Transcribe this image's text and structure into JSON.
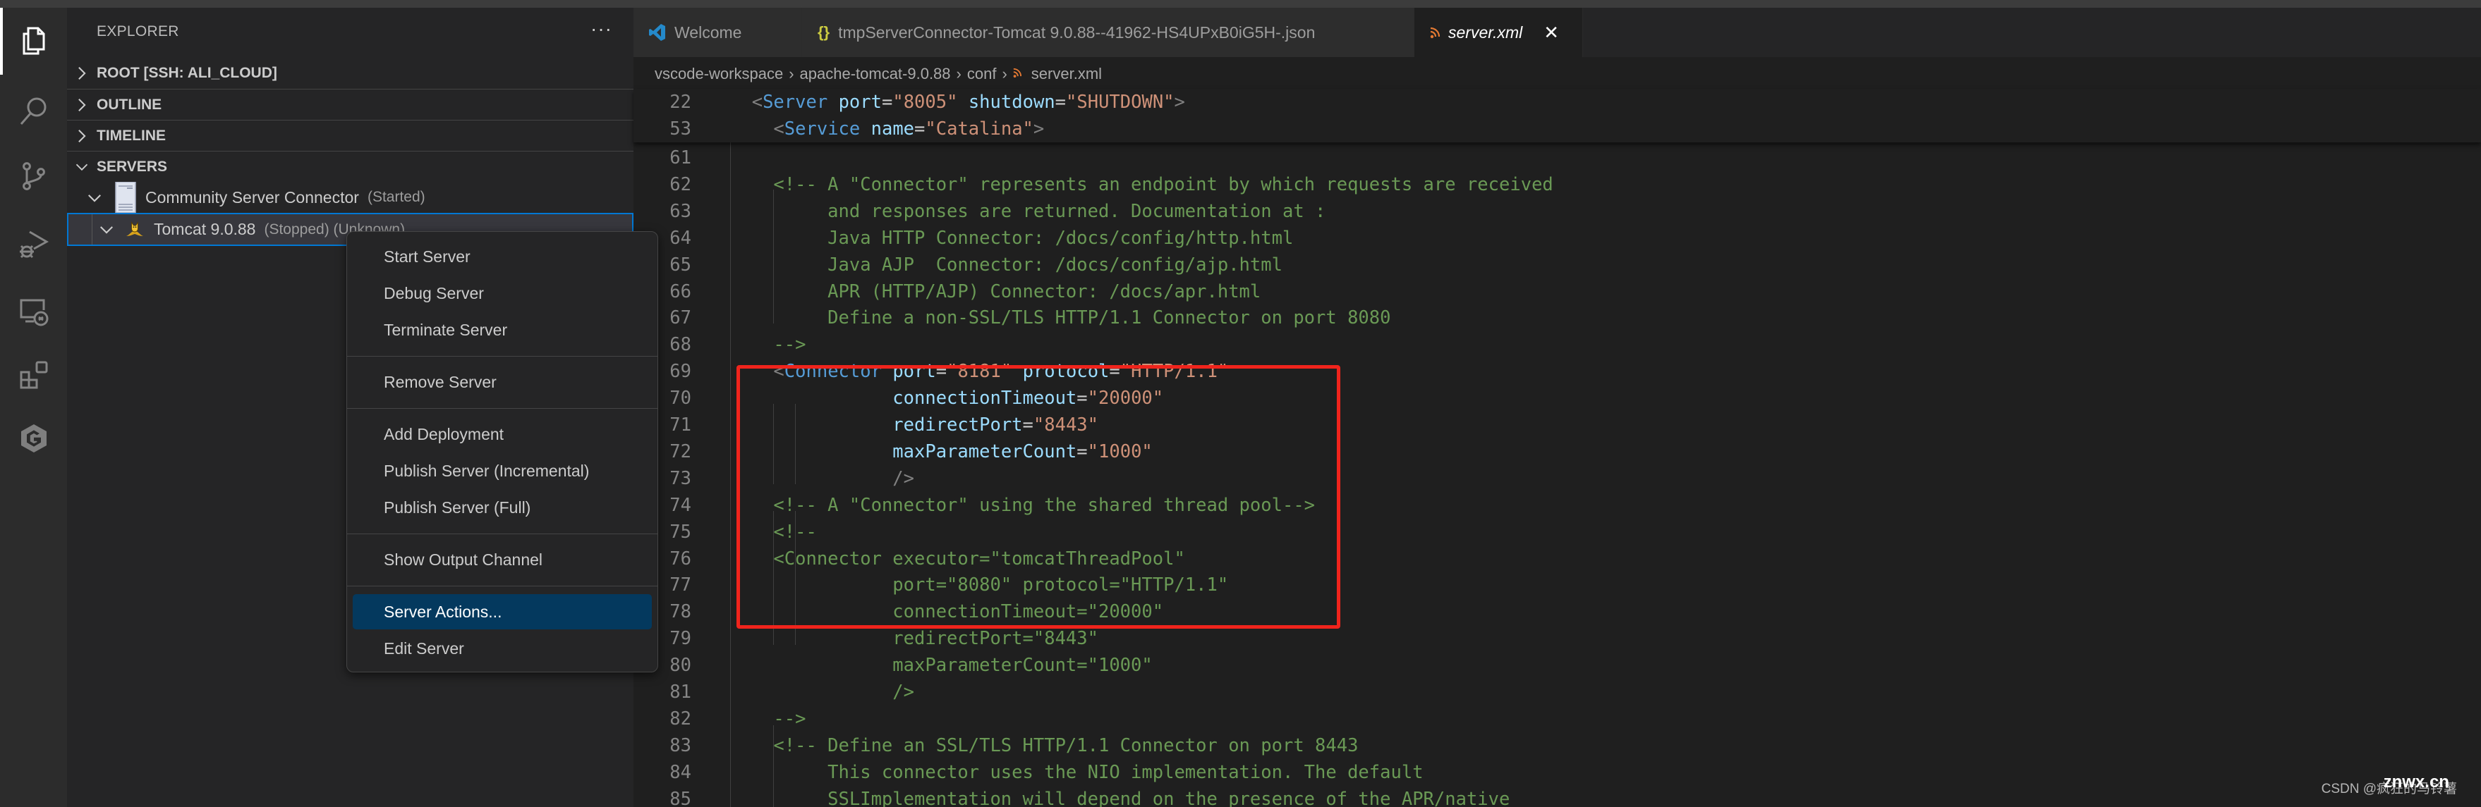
{
  "activity_bar": {
    "items": [
      {
        "name": "explorer",
        "active": true
      },
      {
        "name": "search",
        "active": false
      },
      {
        "name": "source-control",
        "active": false
      },
      {
        "name": "run-and-debug",
        "active": false
      },
      {
        "name": "remote-explorer",
        "active": false
      },
      {
        "name": "extensions",
        "active": false
      },
      {
        "name": "gitlens",
        "active": false
      }
    ]
  },
  "sidebar": {
    "title": "EXPLORER",
    "more_label": "···",
    "sections": [
      {
        "label": "ROOT [SSH: ALI_CLOUD]",
        "expanded": false
      },
      {
        "label": "OUTLINE",
        "expanded": false
      },
      {
        "label": "TIMELINE",
        "expanded": false
      },
      {
        "label": "SERVERS",
        "expanded": true
      }
    ],
    "servers_tree": [
      {
        "label": "Community Server Connector",
        "description": "(Started)",
        "icon": "server-icon",
        "expanded": true
      },
      {
        "label": "Tomcat 9.0.88",
        "description": "(Stopped) (Unknown)",
        "icon": "tomcat-icon",
        "expanded": true,
        "selected": true
      }
    ]
  },
  "context_menu": {
    "groups": [
      [
        "Start Server",
        "Debug Server",
        "Terminate Server"
      ],
      [
        "Remove Server"
      ],
      [
        "Add Deployment",
        "Publish Server (Incremental)",
        "Publish Server (Full)"
      ],
      [
        "Show Output Channel"
      ],
      [
        "Server Actions...",
        "Edit Server"
      ]
    ],
    "items": [
      "Start Server",
      "Debug Server",
      "Terminate Server",
      "Remove Server",
      "Add Deployment",
      "Publish Server (Incremental)",
      "Publish Server (Full)",
      "Show Output Channel",
      "Server Actions...",
      "Edit Server"
    ],
    "highlighted": "Server Actions..."
  },
  "tabs": [
    {
      "label": "Welcome",
      "icon": "vscode-icon",
      "active": false
    },
    {
      "label": "tmpServerConnector-Tomcat 9.0.88--41962-HS4UPxB0iG5H-.json",
      "icon": "json-icon",
      "active": false
    },
    {
      "label": "server.xml",
      "icon": "xml-rss-icon",
      "active": true,
      "close_label": "✕"
    }
  ],
  "breadcrumb": [
    "vscode-workspace",
    "apache-tomcat-9.0.88",
    "conf",
    "server.xml"
  ],
  "sticky_lines": [
    {
      "num": "22",
      "tokens": [
        [
          "  ",
          "pad"
        ],
        [
          "<",
          "bracket"
        ],
        [
          "Server",
          "tag"
        ],
        [
          " ",
          ""
        ],
        [
          "port",
          "attr"
        ],
        [
          "=",
          "eq"
        ],
        [
          "\"8005\"",
          "str"
        ],
        [
          " ",
          ""
        ],
        [
          "shutdown",
          "attr"
        ],
        [
          "=",
          "eq"
        ],
        [
          "\"SHUTDOWN\"",
          "str"
        ],
        [
          ">",
          "bracket"
        ]
      ]
    },
    {
      "num": "53",
      "tokens": [
        [
          "    ",
          "pad"
        ],
        [
          "<",
          "bracket"
        ],
        [
          "Service",
          "tag"
        ],
        [
          " ",
          ""
        ],
        [
          "name",
          "attr"
        ],
        [
          "=",
          "eq"
        ],
        [
          "\"Catalina\"",
          "str"
        ],
        [
          ">",
          "bracket"
        ]
      ]
    }
  ],
  "code_lines": [
    {
      "num": "61",
      "tokens": []
    },
    {
      "num": "62",
      "tokens": [
        [
          "    <!-- A \"Connector\" represents an endpoint by which requests are received",
          "com"
        ]
      ]
    },
    {
      "num": "63",
      "tokens": [
        [
          "         and responses are returned. Documentation at :",
          "com"
        ]
      ]
    },
    {
      "num": "64",
      "tokens": [
        [
          "         Java HTTP Connector: /docs/config/http.html",
          "com"
        ]
      ]
    },
    {
      "num": "65",
      "tokens": [
        [
          "         Java AJP  Connector: /docs/config/ajp.html",
          "com"
        ]
      ]
    },
    {
      "num": "66",
      "tokens": [
        [
          "         APR (HTTP/AJP) Connector: /docs/apr.html",
          "com"
        ]
      ]
    },
    {
      "num": "67",
      "tokens": [
        [
          "         Define a non-SSL/TLS HTTP/1.1 Connector on port 8080",
          "com"
        ]
      ]
    },
    {
      "num": "68",
      "tokens": [
        [
          "    -->",
          "com"
        ]
      ]
    },
    {
      "num": "69",
      "tokens": [
        [
          "    ",
          ""
        ],
        [
          "<",
          "bracket"
        ],
        [
          "Connector",
          "tag"
        ],
        [
          " ",
          ""
        ],
        [
          "port",
          "attr"
        ],
        [
          "=",
          "eq"
        ],
        [
          "\"8181\"",
          "str"
        ],
        [
          " ",
          ""
        ],
        [
          "protocol",
          "attr"
        ],
        [
          "=",
          "eq"
        ],
        [
          "\"HTTP/1.1\"",
          "str"
        ]
      ]
    },
    {
      "num": "70",
      "tokens": [
        [
          "               ",
          ""
        ],
        [
          "connectionTimeout",
          "attr"
        ],
        [
          "=",
          "eq"
        ],
        [
          "\"20000\"",
          "str"
        ]
      ]
    },
    {
      "num": "71",
      "tokens": [
        [
          "               ",
          ""
        ],
        [
          "redirectPort",
          "attr"
        ],
        [
          "=",
          "eq"
        ],
        [
          "\"8443\"",
          "str"
        ]
      ]
    },
    {
      "num": "72",
      "tokens": [
        [
          "               ",
          ""
        ],
        [
          "maxParameterCount",
          "attr"
        ],
        [
          "=",
          "eq"
        ],
        [
          "\"1000\"",
          "str"
        ]
      ]
    },
    {
      "num": "73",
      "tokens": [
        [
          "               ",
          ""
        ],
        [
          "/>",
          "bracket"
        ]
      ]
    },
    {
      "num": "74",
      "tokens": [
        [
          "    <!-- A \"Connector\" using the shared thread pool-->",
          "com"
        ]
      ]
    },
    {
      "num": "75",
      "tokens": [
        [
          "    <!--",
          "com"
        ]
      ]
    },
    {
      "num": "76",
      "tokens": [
        [
          "    <Connector executor=\"tomcatThreadPool\"",
          "com"
        ]
      ]
    },
    {
      "num": "77",
      "tokens": [
        [
          "               port=\"8080\" protocol=\"HTTP/1.1\"",
          "com"
        ]
      ]
    },
    {
      "num": "78",
      "tokens": [
        [
          "               connectionTimeout=\"20000\"",
          "com"
        ]
      ]
    },
    {
      "num": "79",
      "tokens": [
        [
          "               redirectPort=\"8443\"",
          "com"
        ]
      ]
    },
    {
      "num": "80",
      "tokens": [
        [
          "               maxParameterCount=\"1000\"",
          "com"
        ]
      ]
    },
    {
      "num": "81",
      "tokens": [
        [
          "               />",
          "com"
        ]
      ]
    },
    {
      "num": "82",
      "tokens": [
        [
          "    -->",
          "com"
        ]
      ]
    },
    {
      "num": "83",
      "tokens": [
        [
          "    <!-- Define an SSL/TLS HTTP/1.1 Connector on port 8443",
          "com"
        ]
      ]
    },
    {
      "num": "84",
      "tokens": [
        [
          "         This connector uses the NIO implementation. The default",
          "com"
        ]
      ]
    },
    {
      "num": "85",
      "tokens": [
        [
          "         SSLImplementation will depend on the presence of the APR/native",
          "com"
        ]
      ]
    }
  ],
  "annotation": {
    "type": "red-highlight-box",
    "covers_lines": [
      "69",
      "73"
    ]
  },
  "colors": {
    "accent": "#0078d4",
    "menu_highlight": "#04395e",
    "annotation_red": "#f0241c",
    "xml_tag": "#569cd6",
    "xml_attr": "#9cdcfe",
    "xml_string": "#ce9178",
    "comment": "#6a9955"
  },
  "watermark": {
    "text": "CSDN @疯狂的马铃薯",
    "overlay": "znwx.cn"
  }
}
